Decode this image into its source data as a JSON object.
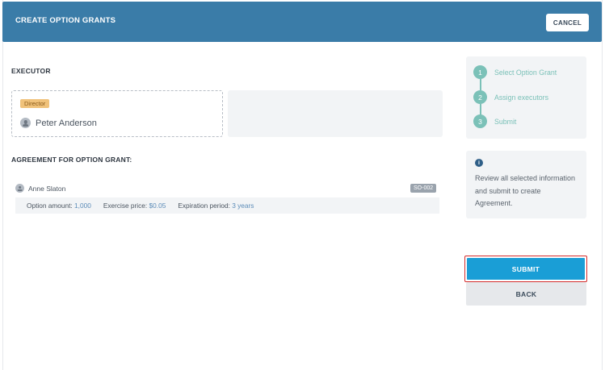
{
  "header": {
    "title": "CREATE OPTION GRANTS",
    "cancel_label": "CANCEL"
  },
  "executor": {
    "section_label": "EXECUTOR",
    "role": "Director",
    "name": "Peter Anderson"
  },
  "agreement": {
    "section_label": "AGREEMENT FOR OPTION GRANT:",
    "holder_name": "Anne Slaton",
    "grant_id": "SO-002",
    "option_amount_label": "Option amount:",
    "option_amount_value": "1,000",
    "exercise_price_label": "Exercise price:",
    "exercise_price_value": "$0.05",
    "expiration_label": "Expiration period:",
    "expiration_value": "3 years"
  },
  "steps": [
    {
      "number": "1",
      "label": "Select Option Grant"
    },
    {
      "number": "2",
      "label": "Assign executors"
    },
    {
      "number": "3",
      "label": "Submit"
    }
  ],
  "info": {
    "icon": "info-icon",
    "text": "Review all selected information and submit to create Agreement."
  },
  "actions": {
    "submit_label": "SUBMIT",
    "back_label": "BACK"
  },
  "colors": {
    "header": "#3a7ca8",
    "accent_step": "#7bc1b8",
    "submit": "#1a9ed6",
    "highlight": "#d42b2b"
  }
}
